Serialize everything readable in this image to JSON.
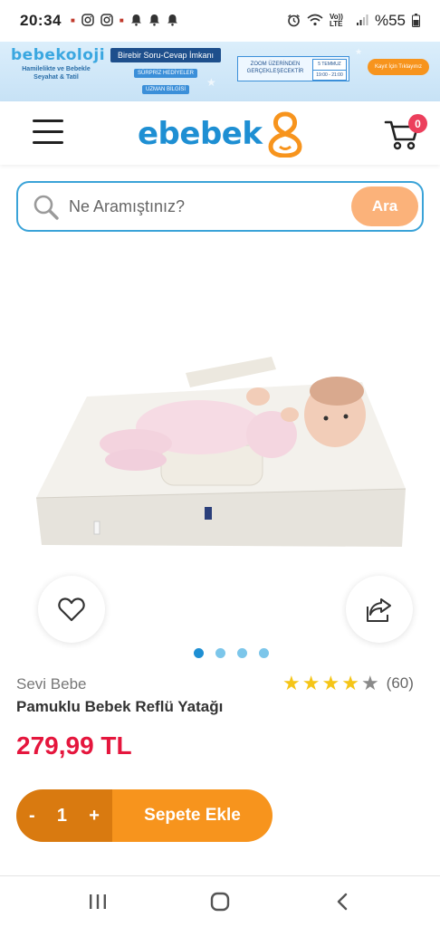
{
  "status_bar": {
    "time": "20:34",
    "network_label": "Vo)) LTE",
    "battery_percent": "%55"
  },
  "banner": {
    "brand": "bebekoloji",
    "tagline": "Hamilelikte ve Bebekle Seyahat & Tatil",
    "headline": "Birebir Soru-Cevap İmkanı",
    "pill_1": "SÜRPRİZ HEDİYELER",
    "pill_2": "UZMAN BİLGİSİ",
    "zoom_text": "ZOOM ÜZERİNDEN GERÇEKLEŞECEKTİR",
    "zoom_date": "5 TEMMUZ 2022",
    "zoom_time": "19:00 - 21:00",
    "cta": "Kayıt İçin Tıklayınız"
  },
  "header": {
    "logo_text": "ebebek",
    "cart_count": "0"
  },
  "search": {
    "placeholder": "Ne Aramıştınız?",
    "button_label": "Ara"
  },
  "product": {
    "brand": "Sevi Bebe",
    "name": "Pamuklu Bebek Reflü Yatağı",
    "price": "279,99 TL",
    "rating_stars": 4,
    "rating_max": 5,
    "review_count": "(60)",
    "image_index": 1,
    "image_total": 4
  },
  "cart_controls": {
    "minus": "-",
    "quantity": "1",
    "plus": "+",
    "add_label": "Sepete Ekle"
  },
  "colors": {
    "brand_blue": "#1e8fd3",
    "brand_orange": "#f7941d",
    "price_red": "#e5163d",
    "badge_pink": "#ec3f5c",
    "star_yellow": "#f5c518"
  }
}
